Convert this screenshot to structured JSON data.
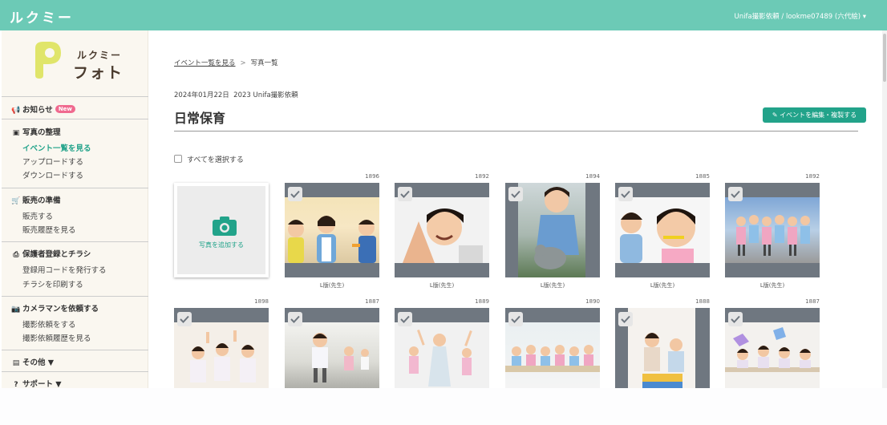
{
  "header": {
    "logo": "ルクミー",
    "user": "Unifa撮影依頼 / lookme07489 (六代絵) ▾"
  },
  "brand": {
    "line1": "ルクミー",
    "line2": "フォト"
  },
  "sidebar": {
    "notice": {
      "label": "お知らせ",
      "badge": "New",
      "icon": "megaphone-icon"
    },
    "photos": {
      "label": "写真の整理",
      "icon": "image-icon",
      "items": [
        "イベント一覧を見る",
        "アップロードする",
        "ダウンロードする"
      ]
    },
    "sales": {
      "label": "販売の準備",
      "icon": "cart-icon",
      "items": [
        "販売する",
        "販売履歴を見る"
      ]
    },
    "guardians": {
      "label": "保護者登録とチラシ",
      "icon": "printer-icon",
      "items": [
        "登録用コードを発行する",
        "チラシを印刷する"
      ]
    },
    "camera": {
      "label": "カメラマンを依頼する",
      "icon": "camera-icon",
      "items": [
        "撮影依頼をする",
        "撮影依頼履歴を見る"
      ]
    },
    "other": {
      "label": "その他 ▼",
      "icon": "list-icon"
    },
    "support": {
      "label": "サポート ▼",
      "icon": "question-icon"
    }
  },
  "breadcrumb": {
    "link": "イベント一覧を見る",
    "sep": ">",
    "current": "写真一覧"
  },
  "event": {
    "date": "2024年01月22日",
    "source": "2023 Unifa撮影依頼",
    "title": "日常保育",
    "edit_button": "✎ イベントを編集・複製する"
  },
  "select_all": "すべてを選択する",
  "add_photo": "写真を追加する",
  "photos": [
    {
      "num": "1896",
      "caption": "L版(先生)"
    },
    {
      "num": "1892",
      "caption": "L版(先生)"
    },
    {
      "num": "1894",
      "caption": "L版(先生)"
    },
    {
      "num": "1885",
      "caption": "L版(先生)"
    },
    {
      "num": "1892",
      "caption": "L版(先生)"
    },
    {
      "num": "1898",
      "caption": ""
    },
    {
      "num": "1887",
      "caption": ""
    },
    {
      "num": "1889",
      "caption": ""
    },
    {
      "num": "1890",
      "caption": ""
    },
    {
      "num": "1888",
      "caption": ""
    },
    {
      "num": "1887",
      "caption": ""
    }
  ],
  "colors": {
    "brand": "#6ccab6",
    "accent": "#22a38a",
    "badge": "#f06a8f",
    "tile_frame": "#6f7780"
  }
}
